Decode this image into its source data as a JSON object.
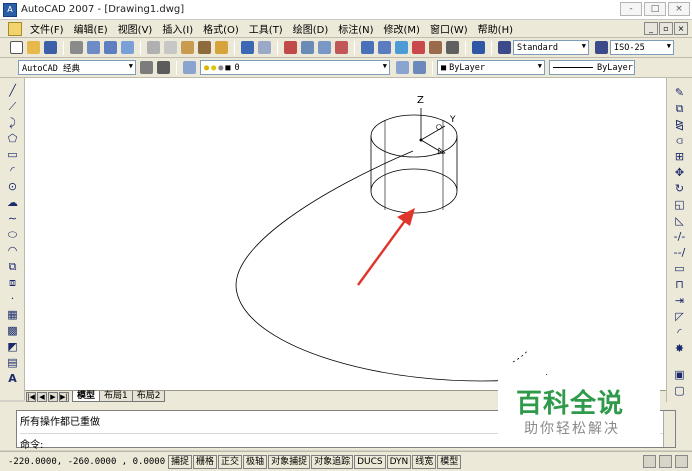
{
  "window": {
    "title": "AutoCAD 2007 - [Drawing1.dwg]",
    "app_icon_text": "A",
    "buttons": [
      "-",
      "□",
      "×"
    ]
  },
  "menu": {
    "items": [
      "文件(F)",
      "编辑(E)",
      "视图(V)",
      "插入(I)",
      "格式(O)",
      "工具(T)",
      "绘图(D)",
      "标注(N)",
      "修改(M)",
      "窗口(W)",
      "帮助(H)"
    ],
    "mdi_buttons": [
      "_",
      "▫",
      "×"
    ]
  },
  "toolbar_standard": {
    "text_style": "Standard",
    "dim_style": "ISO-25"
  },
  "toolbar_layers": {
    "workspace": "AutoCAD 经典",
    "layer": "0",
    "color": "ByLayer",
    "linetype": "ByLayer"
  },
  "drawing": {
    "axis_z": "Z",
    "axis_y": "Y"
  },
  "tabs": {
    "nav": [
      "|◀",
      "◀",
      "▶",
      "▶|"
    ],
    "items": [
      "模型",
      "布局1",
      "布局2"
    ]
  },
  "command": {
    "history": "所有操作都已重做",
    "prompt": "命令:"
  },
  "status": {
    "coordinates": "-220.0000, -260.0000 , 0.0000",
    "toggles": [
      "捕捉",
      "栅格",
      "正交",
      "极轴",
      "对象捕捉",
      "对象追踪",
      "DUCS",
      "DYN",
      "线宽",
      "模型"
    ]
  },
  "watermark": {
    "title": "百科全说",
    "subtitle": "助你轻松解决"
  },
  "colors": {
    "accent_arrow": "#e0352b",
    "watermark_green": "#2e9a4a",
    "ui_face": "#ece9d8"
  }
}
